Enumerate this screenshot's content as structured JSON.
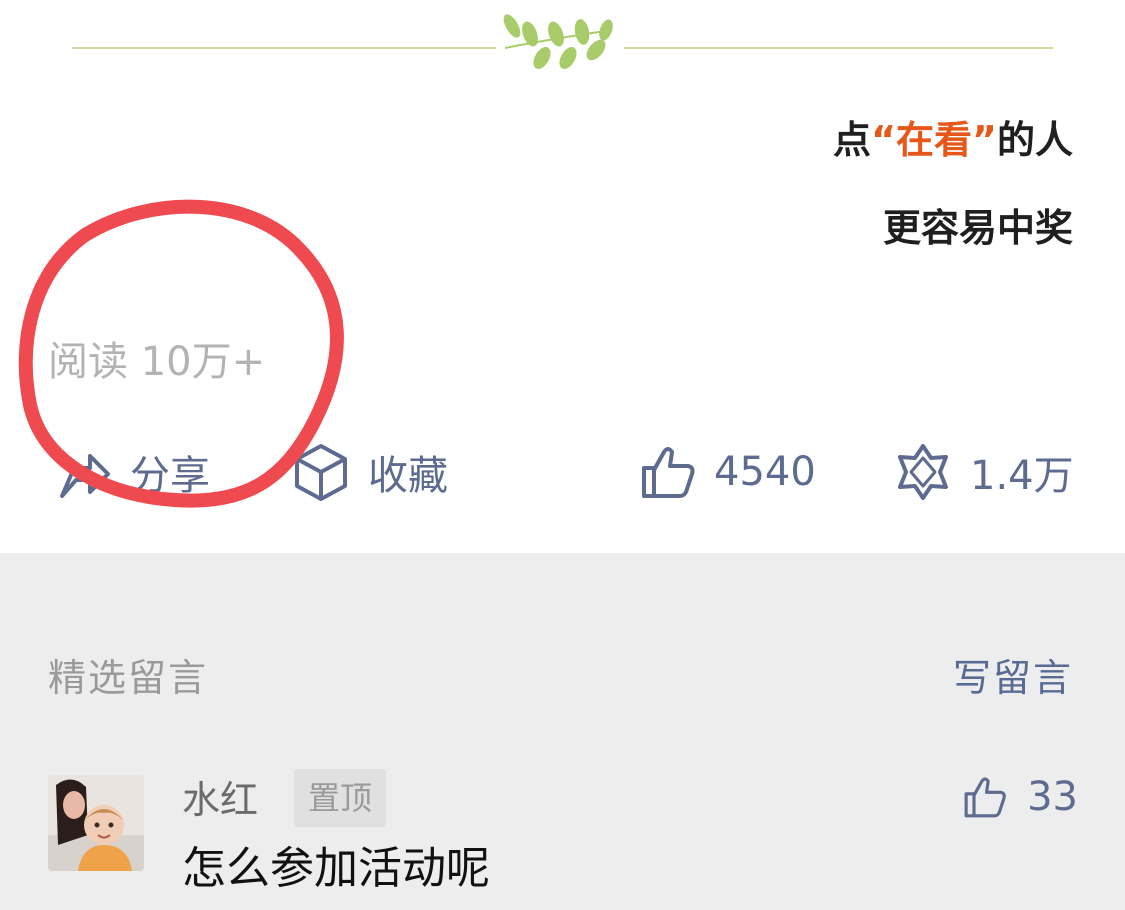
{
  "promo": {
    "line1_prefix": "点",
    "line1_accent": "“在看”",
    "line1_suffix": "的人",
    "line2": "更容易中奖",
    "accent_color": "#e5581a"
  },
  "article": {
    "read_count": "阅读 10万+"
  },
  "actions": {
    "share": {
      "label": "分享",
      "icon": "share-icon"
    },
    "favorite": {
      "label": "收藏",
      "icon": "cube-icon"
    },
    "like": {
      "count": "4540",
      "icon": "thumbs-up-icon"
    },
    "wow": {
      "count": "1.4万",
      "icon": "wow-star-icon"
    },
    "link_color": "#576b95"
  },
  "comments": {
    "section_title": "精选留言",
    "write_label": "写留言",
    "items": [
      {
        "user": "水红",
        "badge": "置顶",
        "text": "怎么参加活动呢",
        "likes": "33"
      }
    ]
  },
  "annotation": {
    "color": "#ee4a4f"
  }
}
